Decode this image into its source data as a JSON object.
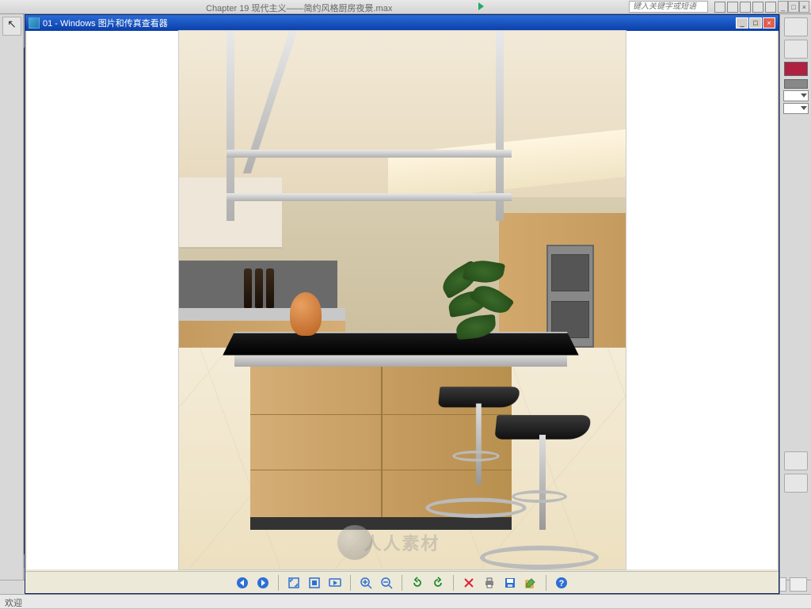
{
  "host": {
    "file_title": "Chapter 19  现代主义——简约风格厨房夜景.max",
    "search_placeholder": "键入关键字或短语",
    "status_prefix": "欢迎",
    "viewport_corner": "[ +"
  },
  "viewer": {
    "window_title": "01 - Windows 图片和传真查看器",
    "watermark": "人人素材",
    "toolbar": {
      "prev": "上一个图像",
      "next": "下一个图像",
      "fit": "最合适大小",
      "actual": "实际大小",
      "slideshow": "开始幻灯片放映",
      "zoom_in": "放大",
      "zoom_out": "缩小",
      "rotate_ccw": "逆时针旋转",
      "rotate_cw": "顺时针旋转",
      "delete": "删除",
      "print": "打印",
      "save": "复制到",
      "edit": "关闭程序并打开图像以便编辑",
      "help": "帮助"
    },
    "win_controls": {
      "min": "_",
      "max": "□",
      "close": "×"
    }
  }
}
